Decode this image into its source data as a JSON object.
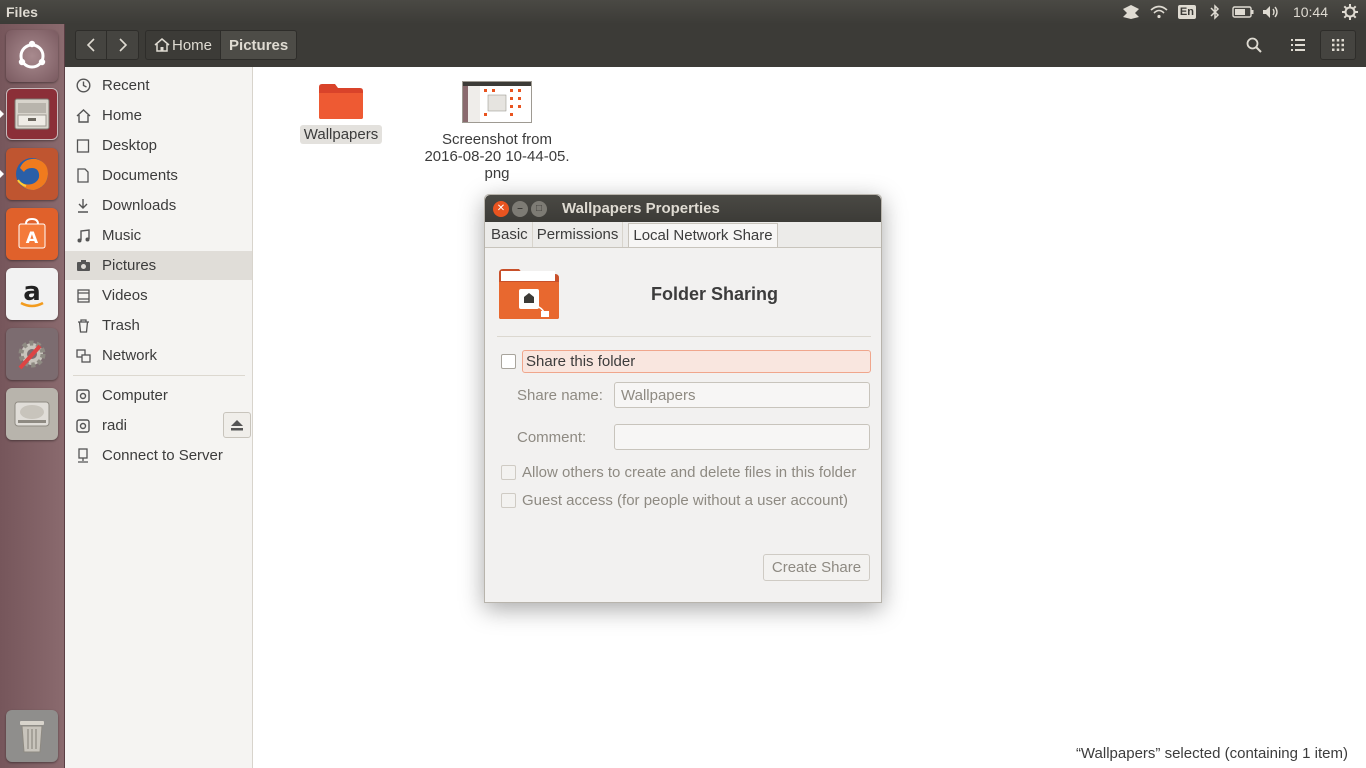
{
  "top_panel": {
    "app_title": "Files",
    "language": "En",
    "clock": "10:44"
  },
  "launcher": {
    "items": [
      "ubuntu-dash",
      "files",
      "firefox",
      "ubuntu-software",
      "amazon",
      "system-settings",
      "disk-drive",
      "trash"
    ]
  },
  "header": {
    "crumbs": [
      "Home",
      "Pictures"
    ]
  },
  "sidebar": {
    "items": [
      "Recent",
      "Home",
      "Desktop",
      "Documents",
      "Downloads",
      "Music",
      "Pictures",
      "Videos",
      "Trash",
      "Network"
    ],
    "devices": [
      "Computer",
      "radi",
      "Connect to Server"
    ]
  },
  "content": {
    "files": [
      {
        "name": "Wallpapers",
        "type": "folder"
      },
      {
        "name_lines": [
          "Screenshot from",
          "2016-08-20 10-44-05.",
          "png"
        ],
        "type": "image"
      }
    ],
    "status": "“Wallpapers” selected  (containing 1 item)"
  },
  "dialog": {
    "title": "Wallpapers Properties",
    "tabs": [
      "Basic",
      "Permissions",
      "Local Network Share"
    ],
    "heading": "Folder Sharing",
    "share_checkbox": "Share this folder",
    "share_name_label": "Share name:",
    "share_name_value": "Wallpapers",
    "comment_label": "Comment:",
    "comment_value": "",
    "allow_others": "Allow others to create and delete files in this folder",
    "guest_access": "Guest access (for people without a user account)",
    "create_button": "Create Share"
  },
  "colors": {
    "accent": "#e95420",
    "panel": "#3c3b37",
    "launcher": "#7e5e63"
  }
}
